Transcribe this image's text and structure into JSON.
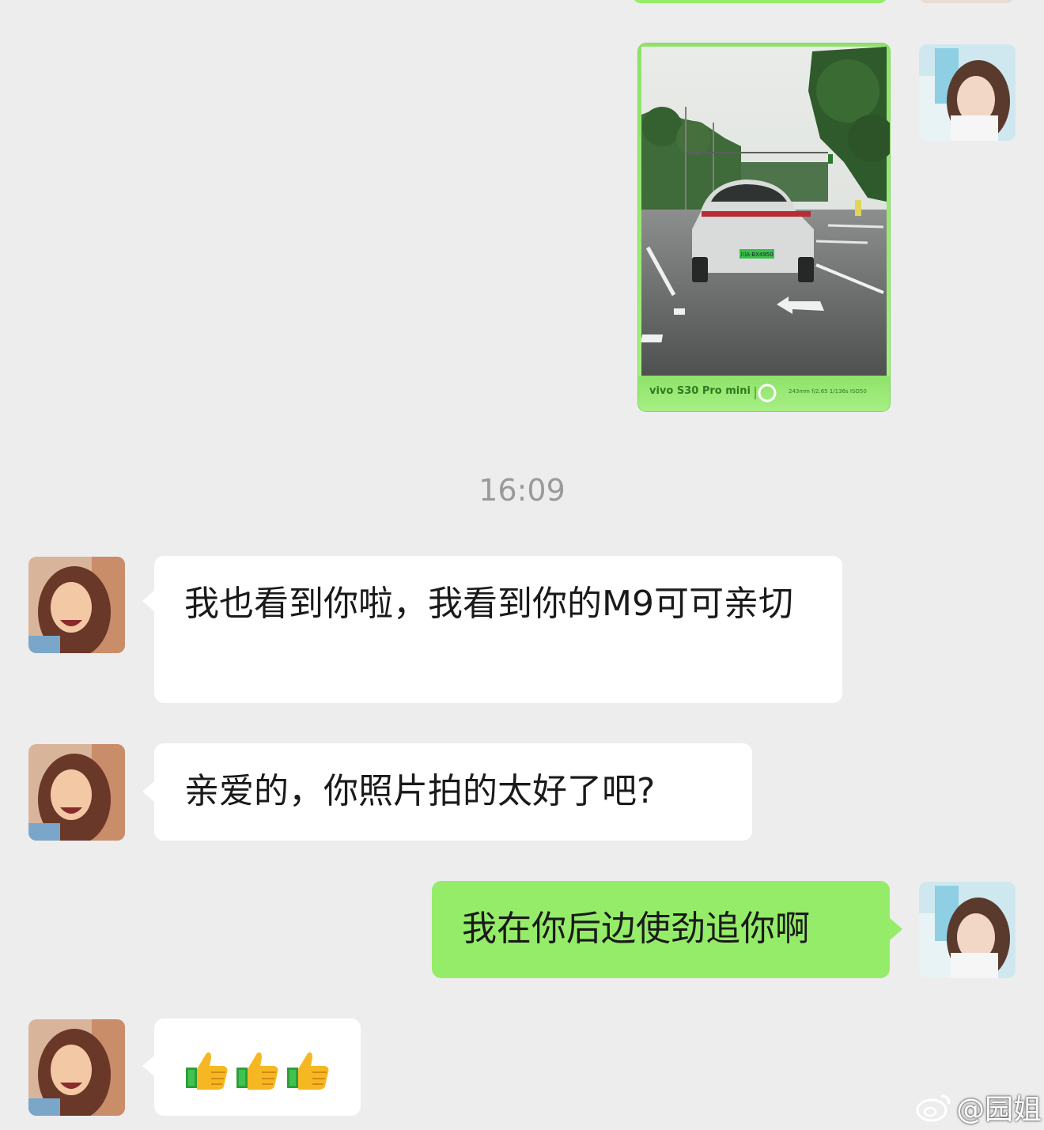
{
  "colors": {
    "background": "#ededed",
    "incoming_bubble": "#ffffff",
    "outgoing_bubble": "#95ec69",
    "timestamp": "#9a9a9a"
  },
  "photo_message": {
    "camera_brand": "vivo S30 Pro mini",
    "exif": "243mm  f/2.65  1/136s  ISO50",
    "plate": "川A·BX4950"
  },
  "timestamp": "16:09",
  "messages": [
    {
      "direction": "incoming",
      "text": "我也看到你啦，我看到你的M9可可亲切"
    },
    {
      "direction": "incoming",
      "text": "亲爱的，你照片拍的太好了吧?"
    },
    {
      "direction": "outgoing",
      "text": "我在你后边使劲追你啊"
    },
    {
      "direction": "incoming",
      "emoji": [
        "thumbs-up",
        "thumbs-up",
        "thumbs-up"
      ]
    }
  ],
  "watermark": {
    "icon": "weibo-icon",
    "text": "@园姐"
  }
}
